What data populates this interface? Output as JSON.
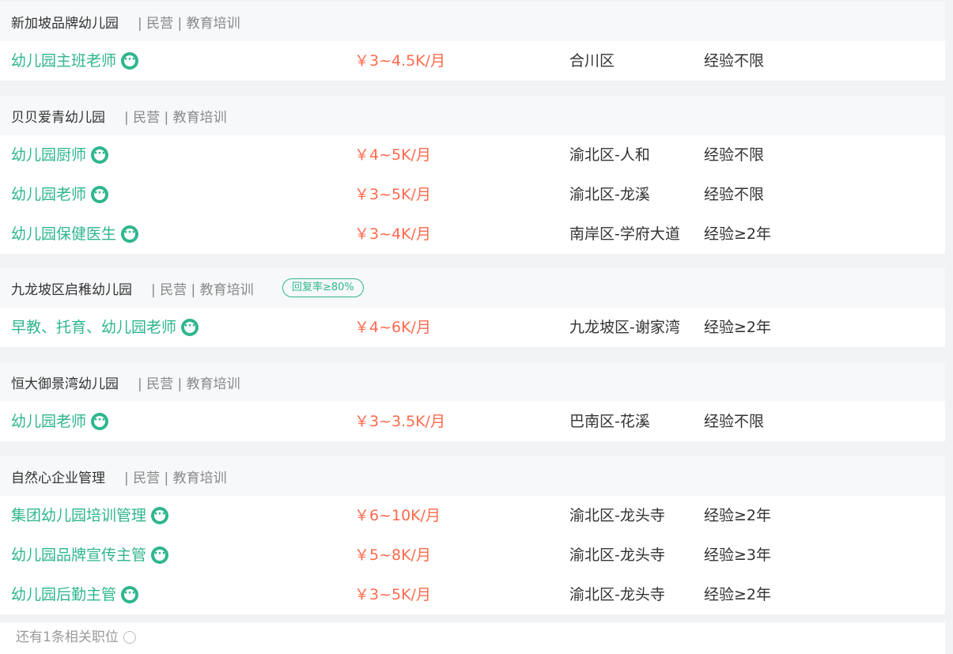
{
  "companies": [
    {
      "name": "新加坡品牌幼儿园",
      "tags": "| 民营 | 教育培训",
      "jobs": [
        {
          "title": "幼儿园主班老师",
          "salary": "￥3~4.5K/月",
          "location": "合川区",
          "experience": "经验不限"
        }
      ]
    },
    {
      "name": "贝贝爱青幼儿园",
      "tags": "| 民营 | 教育培训",
      "jobs": [
        {
          "title": "幼儿园厨师",
          "salary": "￥4~5K/月",
          "location": "渝北区-人和",
          "experience": "经验不限"
        },
        {
          "title": "幼儿园老师",
          "salary": "￥3~5K/月",
          "location": "渝北区-龙溪",
          "experience": "经验不限"
        },
        {
          "title": "幼儿园保健医生",
          "salary": "￥3~4K/月",
          "location": "南岸区-学府大道",
          "experience": "经验≥2年"
        }
      ]
    },
    {
      "name": "九龙坡区启稚幼儿园",
      "tags": "| 民营 | 教育培训",
      "badge": "回复率≥80%",
      "jobs": [
        {
          "title": "早教、托育、幼儿园老师",
          "salary": "￥4~6K/月",
          "location": "九龙坡区-谢家湾",
          "experience": "经验≥2年"
        }
      ]
    },
    {
      "name": "恒大御景湾幼儿园",
      "tags": "| 民营 | 教育培训",
      "jobs": [
        {
          "title": "幼儿园老师",
          "salary": "￥3~3.5K/月",
          "location": "巴南区-花溪",
          "experience": "经验不限"
        }
      ]
    },
    {
      "name": "自然心企业管理",
      "tags": "| 民营 | 教育培训",
      "jobs": [
        {
          "title": "集团幼儿园培训管理",
          "salary": "￥6~10K/月",
          "location": "渝北区-龙头寺",
          "experience": "经验≥2年"
        },
        {
          "title": "幼儿园品牌宣传主管",
          "salary": "￥5~8K/月",
          "location": "渝北区-龙头寺",
          "experience": "经验≥3年"
        },
        {
          "title": "幼儿园后勤主管",
          "salary": "￥3~5K/月",
          "location": "渝北区-龙头寺",
          "experience": "经验≥2年"
        }
      ]
    }
  ],
  "more_jobs_text": "还有1条相关职位"
}
